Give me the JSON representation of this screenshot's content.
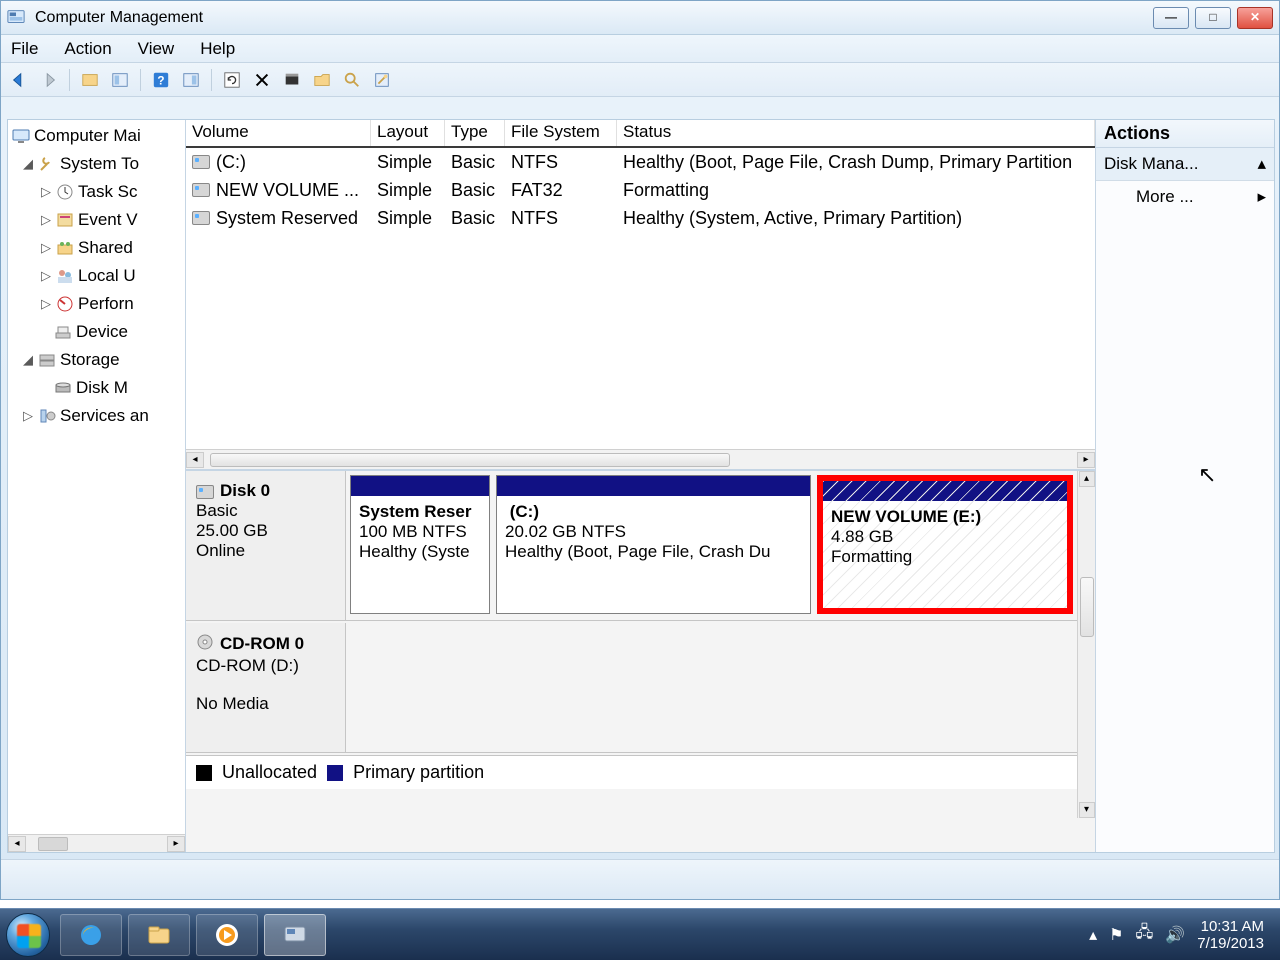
{
  "window": {
    "title": "Computer Management"
  },
  "menu": {
    "file": "File",
    "action": "Action",
    "view": "View",
    "help": "Help"
  },
  "tree": {
    "root": "Computer Mai",
    "system_tools": "System To",
    "task_scheduler": "Task Sc",
    "event_viewer": "Event V",
    "shared_folders": "Shared",
    "local_users": "Local U",
    "performance": "Perforn",
    "device_manager": "Device",
    "storage": "Storage",
    "disk_management": "Disk M",
    "services": "Services an"
  },
  "vol_headers": {
    "volume": "Volume",
    "layout": "Layout",
    "type": "Type",
    "fs": "File System",
    "status": "Status"
  },
  "volumes": [
    {
      "name": "(C:)",
      "layout": "Simple",
      "type": "Basic",
      "fs": "NTFS",
      "status": "Healthy (Boot, Page File, Crash Dump, Primary Partition"
    },
    {
      "name": "NEW VOLUME ...",
      "layout": "Simple",
      "type": "Basic",
      "fs": "FAT32",
      "status": "Formatting"
    },
    {
      "name": "System Reserved",
      "layout": "Simple",
      "type": "Basic",
      "fs": "NTFS",
      "status": "Healthy (System, Active, Primary Partition)"
    }
  ],
  "disk0": {
    "label": "Disk 0",
    "type": "Basic",
    "size": "25.00 GB",
    "state": "Online",
    "p1": {
      "name": "System Reser",
      "info": "100 MB NTFS",
      "status": "Healthy (Syste"
    },
    "p2": {
      "name": "(C:)",
      "info": "20.02 GB NTFS",
      "status": "Healthy (Boot, Page File, Crash Du"
    },
    "p3": {
      "name": "NEW VOLUME  (E:)",
      "info": "4.88 GB",
      "status": "Formatting"
    }
  },
  "cdrom": {
    "label": "CD-ROM 0",
    "drive": "CD-ROM (D:)",
    "state": "No Media"
  },
  "legend": {
    "unallocated": "Unallocated",
    "primary": "Primary partition"
  },
  "actions": {
    "header": "Actions",
    "disk_mgmt": "Disk Mana...",
    "more": "More ..."
  },
  "tray": {
    "time": "10:31 AM",
    "date": "7/19/2013"
  }
}
